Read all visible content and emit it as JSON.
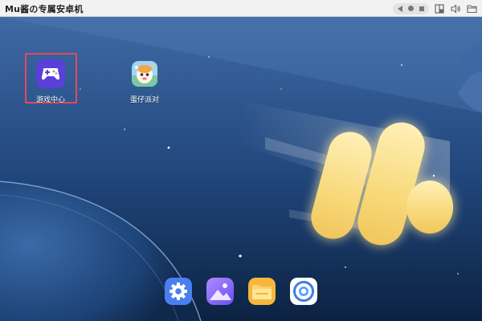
{
  "window": {
    "title": "Mu酱の专属安卓机"
  },
  "toolbar": {
    "nav_buttons": [
      "back-icon",
      "home-icon",
      "recent-apps-icon"
    ],
    "icons": [
      "split-screen-icon",
      "volume-icon",
      "folder-icon"
    ]
  },
  "desktop": {
    "apps": [
      {
        "label": "游戏中心",
        "icon": "gamepad-icon",
        "selected": true
      },
      {
        "label": "蛋仔派对",
        "icon": "eggy-party-icon",
        "selected": false
      }
    ],
    "dock": [
      "settings-icon",
      "gallery-icon",
      "file-manager-icon",
      "browser-icon"
    ]
  },
  "colors": {
    "sky_top": "#3d6aa6",
    "sky_bottom": "#0c2242",
    "accent_selection": "#e34a5a",
    "game_center": "#5a3fd8"
  }
}
